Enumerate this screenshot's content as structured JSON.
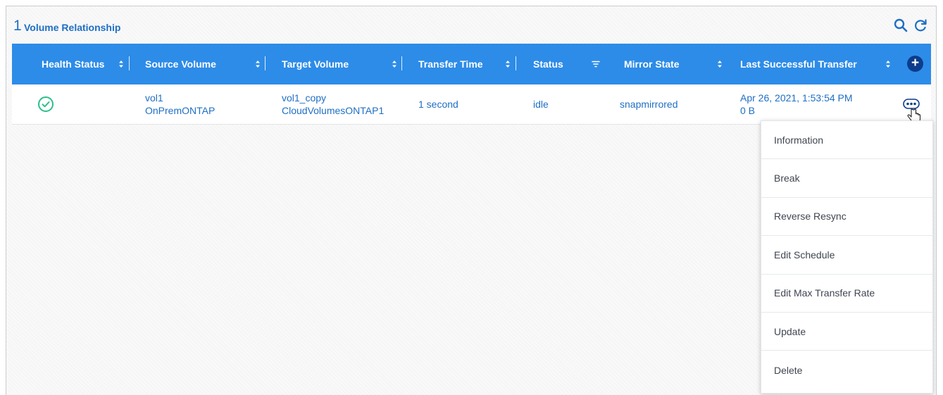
{
  "header": {
    "count": "1",
    "title": "Volume Relationship",
    "icons": [
      "search-icon",
      "refresh-icon"
    ]
  },
  "table": {
    "columns": [
      "Health Status",
      "Source Volume",
      "Target Volume",
      "Transfer Time",
      "Status",
      "Mirror State",
      "Last Successful Transfer"
    ],
    "rows": [
      {
        "health": "healthy",
        "source_volume": "vol1",
        "source_system": "OnPremONTAP",
        "target_volume": "vol1_copy",
        "target_system": "CloudVolumesONTAP1",
        "transfer_time": "1 second",
        "status": "idle",
        "mirror_state": "snapmirrored",
        "last_transfer_date": "Apr 26, 2021, 1:53:54 PM",
        "last_transfer_size": "0 B"
      }
    ]
  },
  "menu": {
    "items": [
      "Information",
      "Break",
      "Reverse Resync",
      "Edit Schedule",
      "Edit Max Transfer Rate",
      "Update",
      "Delete"
    ]
  },
  "colors": {
    "header_bg": "#2d8ce8",
    "link": "#1f6fc4",
    "healthy": "#2bbf8a",
    "add_button": "#0c3c8c"
  }
}
